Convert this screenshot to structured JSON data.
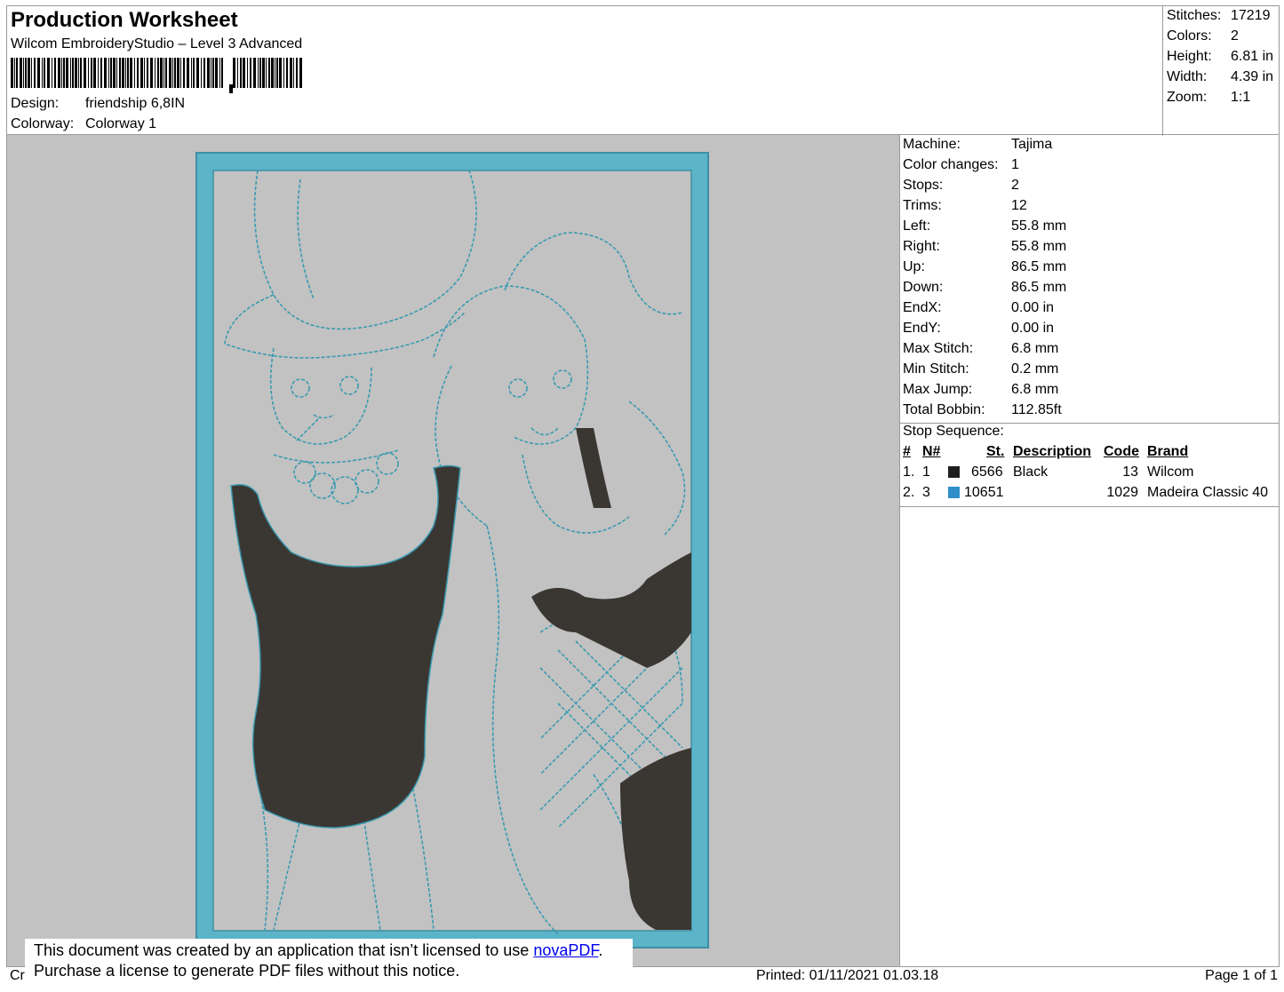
{
  "header": {
    "title": "Production Worksheet",
    "subtitle": "Wilcom EmbroideryStudio – Level 3 Advanced",
    "design_label": "Design:",
    "design_value": "friendship 6,8IN",
    "colorway_label": "Colorway:",
    "colorway_value": "Colorway 1"
  },
  "stats": [
    {
      "label": "Stitches:",
      "value": "17219"
    },
    {
      "label": "Colors:",
      "value": "2"
    },
    {
      "label": "Height:",
      "value": "6.81 in"
    },
    {
      "label": "Width:",
      "value": "4.39 in"
    },
    {
      "label": "Zoom:",
      "value": "1:1"
    }
  ],
  "details": [
    {
      "label": "Machine:",
      "value": "Tajima"
    },
    {
      "label": "Color changes:",
      "value": "1"
    },
    {
      "label": "Stops:",
      "value": "2"
    },
    {
      "label": "Trims:",
      "value": "12"
    },
    {
      "label": "Left:",
      "value": "55.8 mm"
    },
    {
      "label": "Right:",
      "value": "55.8 mm"
    },
    {
      "label": "Up:",
      "value": "86.5 mm"
    },
    {
      "label": "Down:",
      "value": "86.5 mm"
    },
    {
      "label": "EndX:",
      "value": "0.00 in"
    },
    {
      "label": "EndY:",
      "value": "0.00 in"
    },
    {
      "label": "Max Stitch:",
      "value": "6.8 mm"
    },
    {
      "label": "Min Stitch:",
      "value": "0.2 mm"
    },
    {
      "label": "Max Jump:",
      "value": "6.8 mm"
    },
    {
      "label": "Total Bobbin:",
      "value": "112.85ft"
    }
  ],
  "stop_sequence": {
    "title": "Stop Sequence:",
    "columns": [
      "#",
      "N#",
      "St.",
      "Description",
      "Code",
      "Brand"
    ],
    "rows": [
      {
        "idx": "1.",
        "n": "1",
        "color": "#1e1e1e",
        "st": "6566",
        "desc": "Black",
        "code": "13",
        "brand": "Wilcom"
      },
      {
        "idx": "2.",
        "n": "3",
        "color": "#2f8ec9",
        "st": "10651",
        "desc": "",
        "code": "1029",
        "brand": "Madeira Classic 40"
      }
    ]
  },
  "footer": {
    "left": "Cr",
    "printed": "Printed: 01/11/2021 01.03.18",
    "page": "Page 1 of 1"
  },
  "notice": {
    "line1_pre": "This document was created by an application that isn’t licensed to use ",
    "link": "novaPDF",
    "line1_post": ".",
    "line2": "Purchase a license to generate PDF files without this notice."
  },
  "colors": {
    "frame": "#4aa3b8",
    "fill_dark": "#3a3733",
    "canvas_bg": "#c2c2c2"
  }
}
